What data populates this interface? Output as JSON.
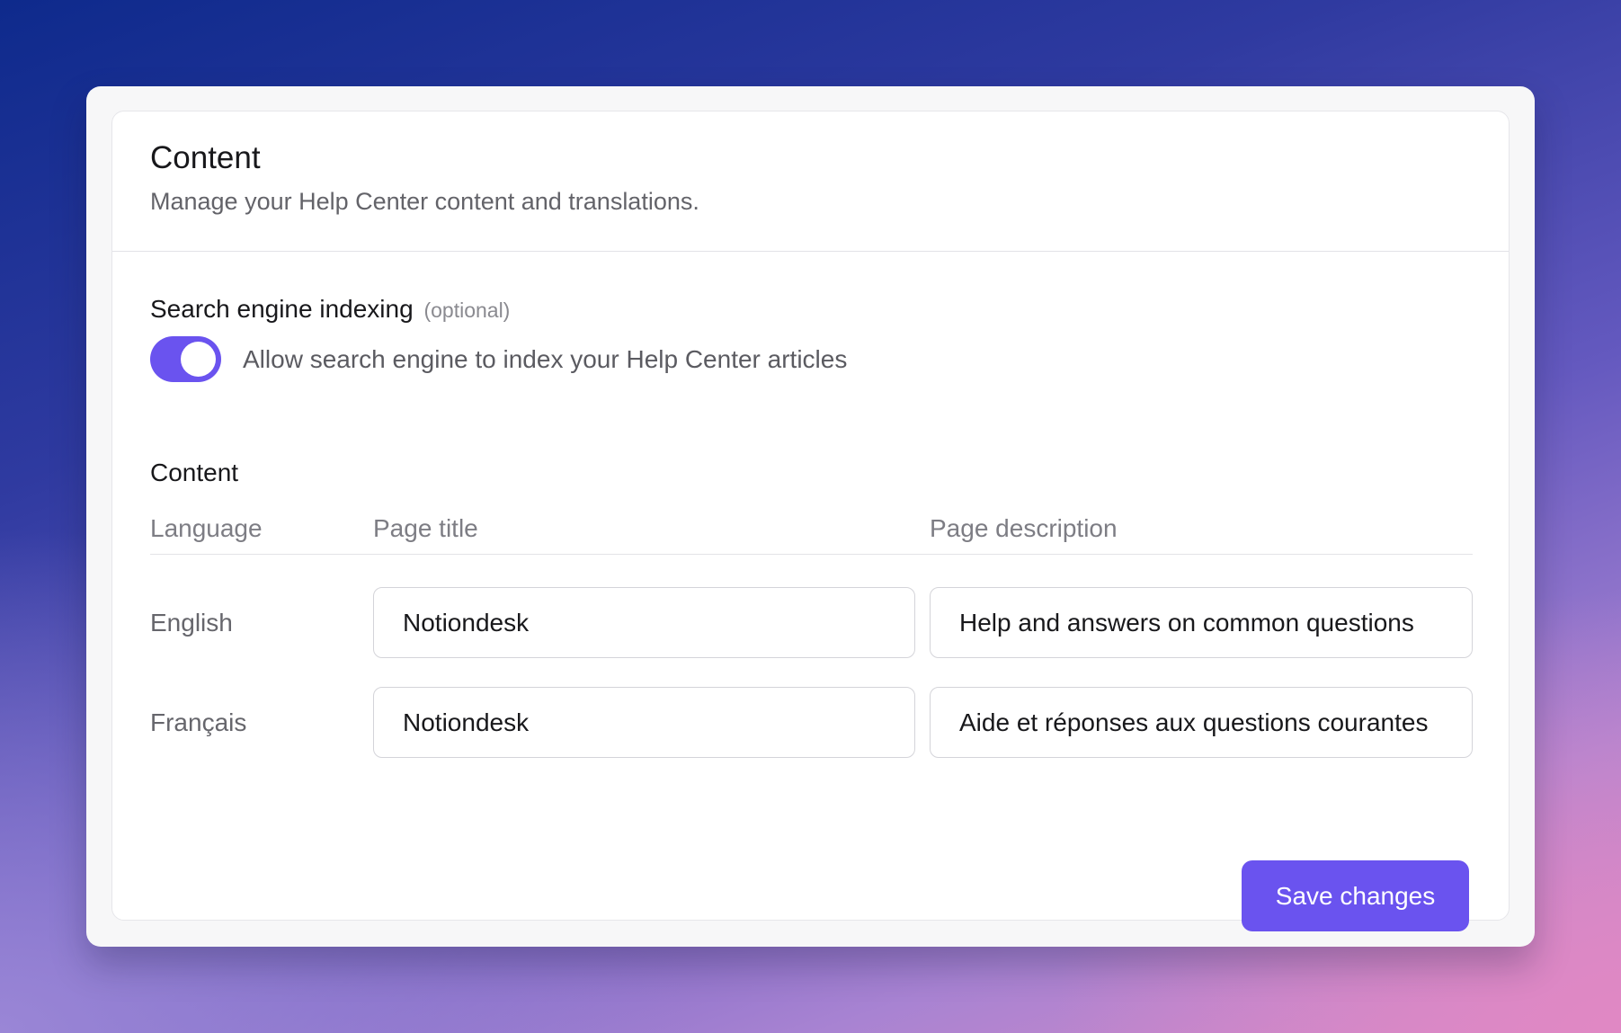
{
  "header": {
    "title": "Content",
    "subtitle": "Manage your Help Center content and translations."
  },
  "indexing": {
    "label": "Search engine indexing",
    "optional": "(optional)",
    "toggle_on": true,
    "toggle_text": "Allow search engine to index your Help Center articles"
  },
  "content": {
    "label": "Content",
    "columns": {
      "language": "Language",
      "page_title": "Page title",
      "page_description": "Page description"
    },
    "rows": [
      {
        "language": "English",
        "page_title": "Notiondesk",
        "page_description": "Help and answers on common questions"
      },
      {
        "language": "Français",
        "page_title": "Notiondesk",
        "page_description": "Aide et réponses aux questions courantes"
      }
    ]
  },
  "actions": {
    "save_label": "Save changes"
  },
  "colors": {
    "accent": "#6a53ef"
  }
}
